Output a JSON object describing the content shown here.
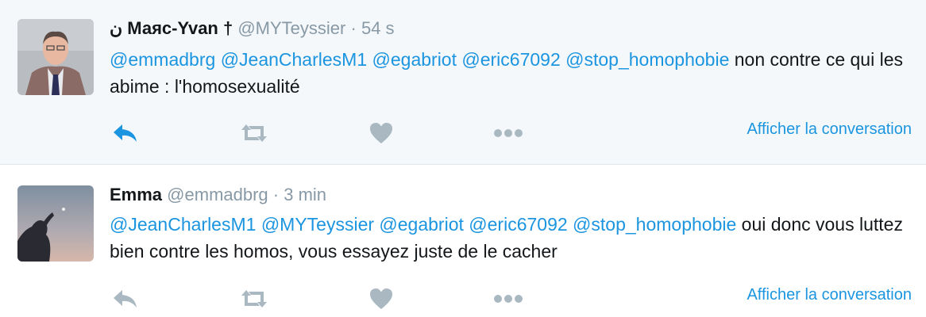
{
  "tweets": [
    {
      "name": "ن Маяс-Yvan †",
      "handle": "@MYTeyssier",
      "sep": "·",
      "time": "54 s",
      "mentions": [
        "@emmadbrg",
        "@JeanCharlesM1",
        "@egabriot",
        "@eric67092",
        "@stop_homophobie"
      ],
      "text": "non contre ce qui les abime : l'homosexualité",
      "conversation_label": "Afficher la conversation"
    },
    {
      "name": "Emma",
      "handle": "@emmadbrg",
      "sep": "·",
      "time": "3 min",
      "mentions": [
        "@JeanCharlesM1",
        "@MYTeyssier",
        "@egabriot",
        "@eric67092",
        "@stop_homophobie"
      ],
      "text": "oui donc vous luttez bien contre les homos, vous essayez juste de le cacher",
      "conversation_label": "Afficher la conversation"
    }
  ],
  "colors": {
    "mention": "#1b95e0",
    "muted": "#8899a6",
    "highlight_bg": "#f5f8fa",
    "reply_active": "#1b95e0",
    "icon_gray": "#aab8c2"
  },
  "icons": [
    "reply-icon",
    "retweet-icon",
    "heart-icon",
    "more-icon"
  ]
}
